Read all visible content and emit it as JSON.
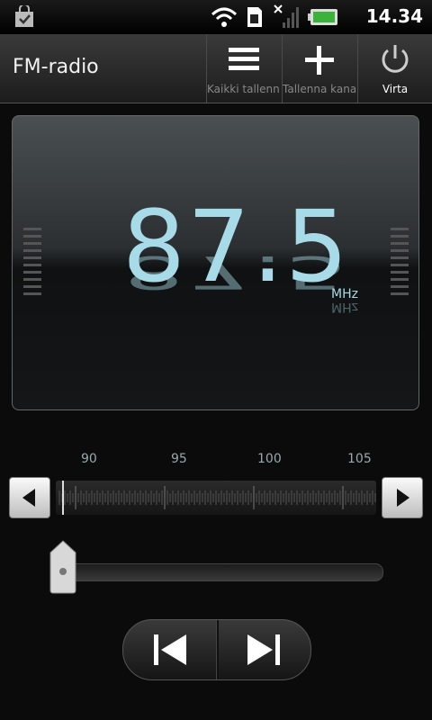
{
  "status": {
    "time": "14.34"
  },
  "app": {
    "title": "FM-radio"
  },
  "actions": [
    {
      "label": "Kaikki tallennetut"
    },
    {
      "label": "Tallenna kanava"
    },
    {
      "label": "Virta"
    }
  ],
  "radio": {
    "frequency": "87.5",
    "unit": "MHz"
  },
  "scale": {
    "labels": [
      "90",
      "95",
      "100",
      "105"
    ]
  },
  "volume": {
    "level": 0.0
  },
  "colors": {
    "accent": "#a8dbe8",
    "background": "#0b0b0b"
  }
}
